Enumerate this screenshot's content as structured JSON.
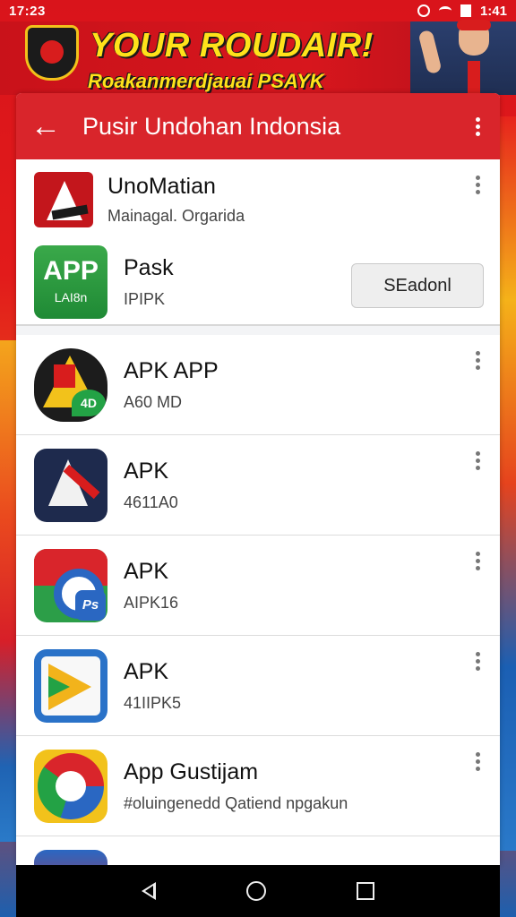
{
  "status_bar": {
    "time": "17:23",
    "right_text": "1:41"
  },
  "banner": {
    "title": "YOUR ROUDAIR!",
    "subtitle": "Roakanmerdjauai PSAYK"
  },
  "header": {
    "title": "Pusir Undohan Indonsia",
    "back_icon": "arrow-left-icon",
    "menu_icon": "overflow-menu-icon"
  },
  "top_items": [
    {
      "name": "UnoMatian",
      "subtitle": "Mainagal. Orgarida"
    },
    {
      "name": "Pask",
      "subtitle": "IPIPK",
      "icon_text": "APP",
      "icon_subtext": "LAI8n",
      "button_label": "SEadonl"
    }
  ],
  "items": [
    {
      "name": "APK APP",
      "subtitle": "A60 MD",
      "badge": "4D"
    },
    {
      "name": "APK",
      "subtitle": "4611A0"
    },
    {
      "name": "APK",
      "subtitle": "AIPK16",
      "badge": "Ps"
    },
    {
      "name": "APK",
      "subtitle": "41IIPK5"
    },
    {
      "name": "App Gustijam",
      "subtitle": "#oluingenedd Qatiend npgakun"
    }
  ],
  "colors": {
    "accent_red": "#d9252b",
    "banner_yellow": "#ffe21a",
    "card_bg": "#f3f4f6"
  }
}
